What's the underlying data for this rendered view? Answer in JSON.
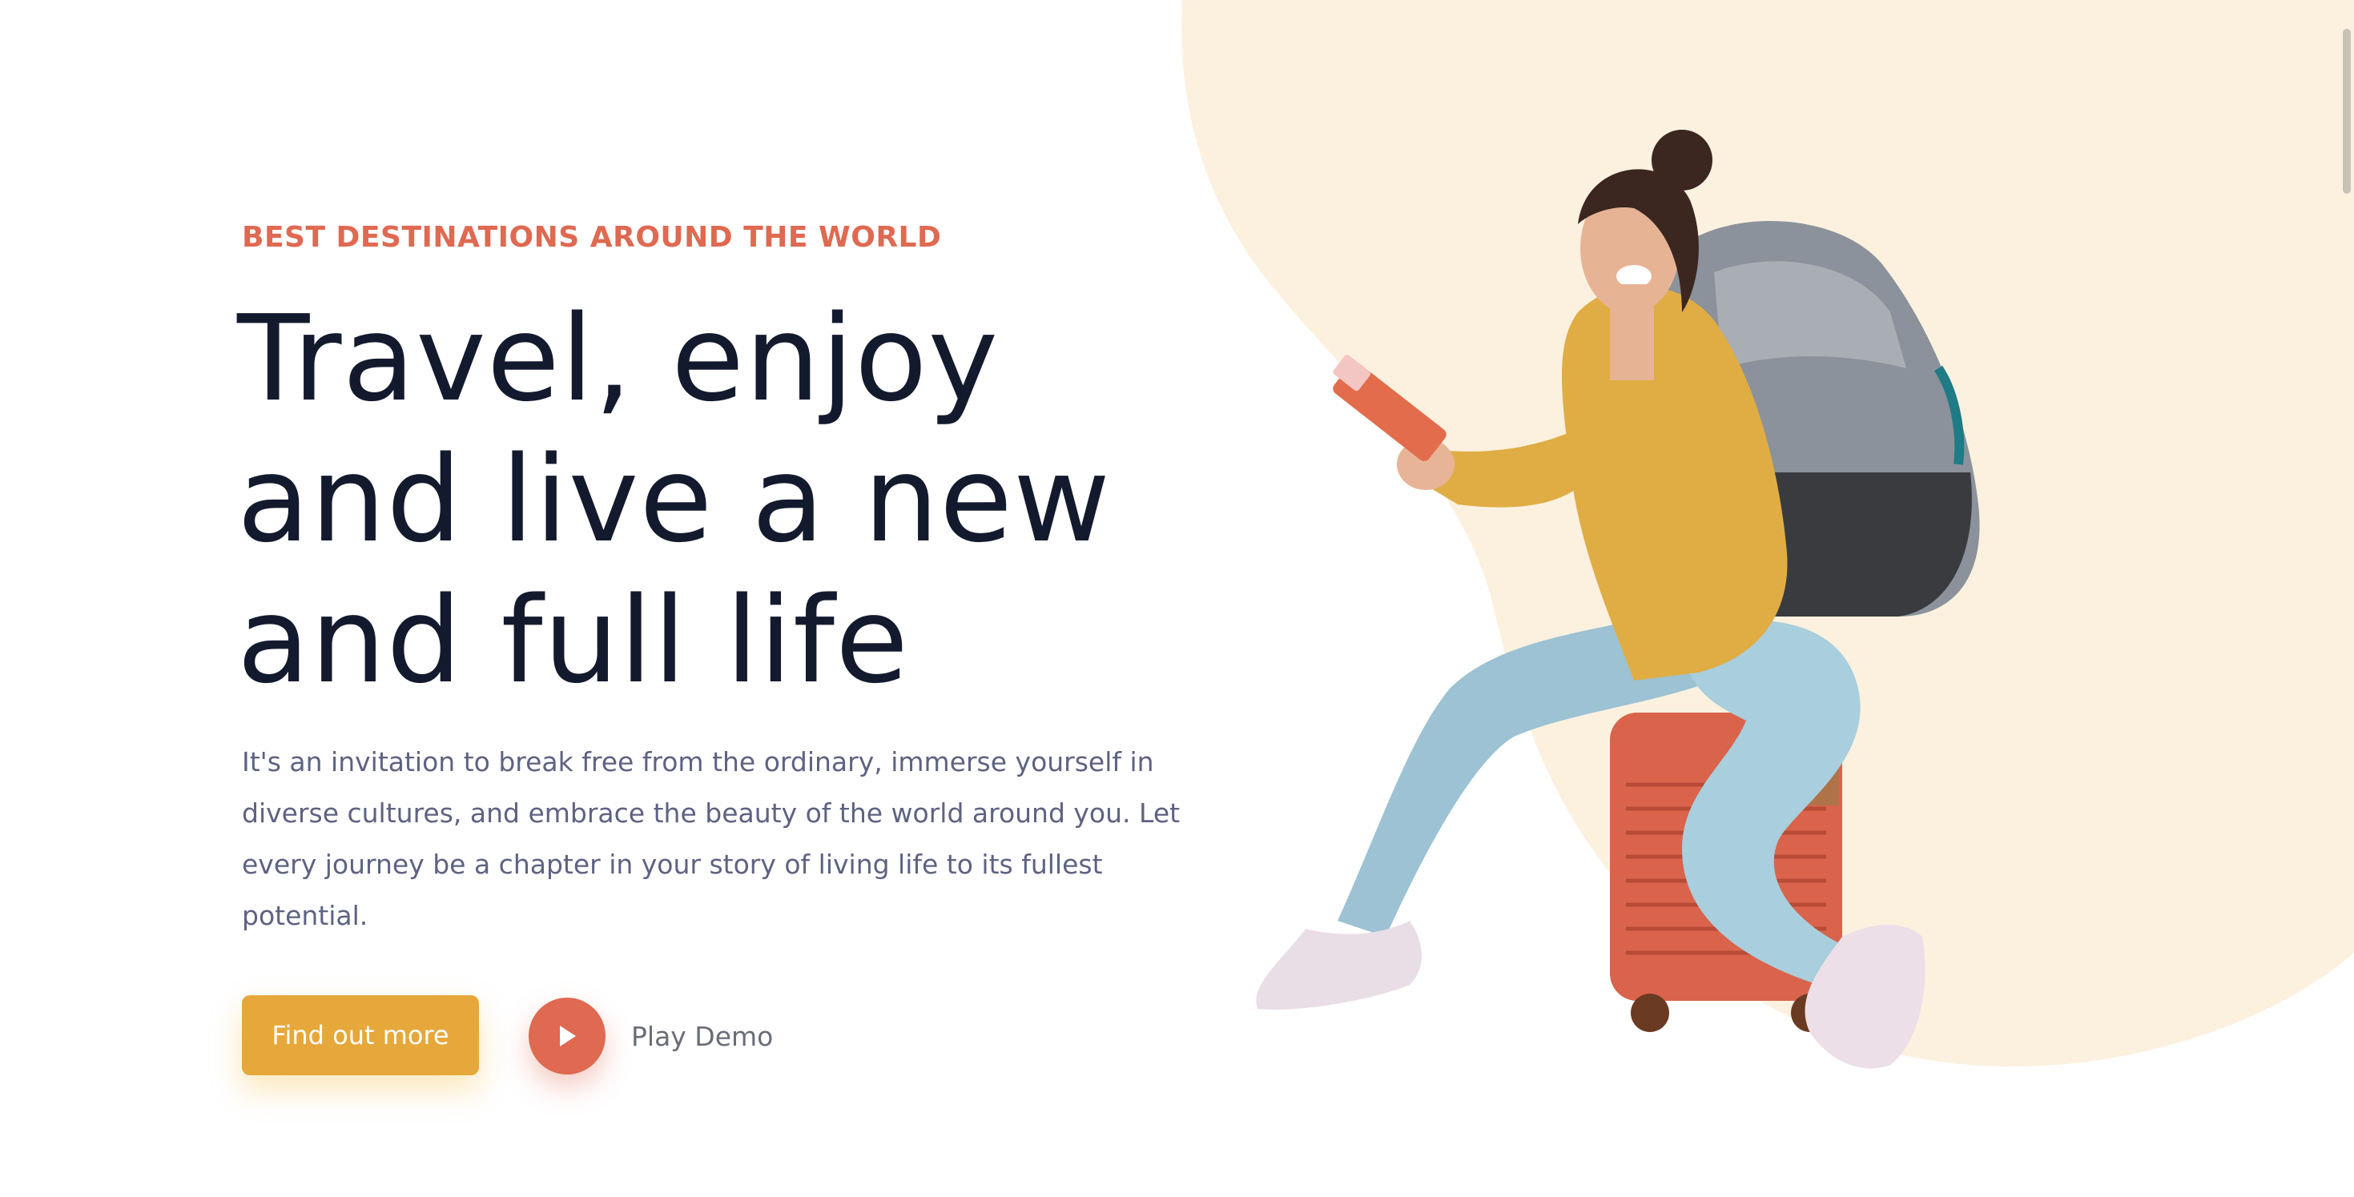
{
  "hero": {
    "eyebrow": "BEST DESTINATIONS AROUND THE WORLD",
    "headline_lines": [
      "Travel, enjoy",
      "and live a new",
      "and full life"
    ],
    "description_lines": [
      "It's an invitation to break free from the ordinary, immerse yourself in",
      "diverse cultures, and embrace the beauty of the world around you. Let",
      "every journey be a chapter in your story of living life to its fullest",
      "potential."
    ],
    "cta_label": "Find out more",
    "play_label": "Play Demo",
    "image_subject": "traveler-sitting-on-suitcase-with-backpack"
  },
  "icons": {
    "play": "play-icon"
  },
  "colors": {
    "eyebrow": "#df6951",
    "headline": "#141a2e",
    "body_text": "#5e6282",
    "cta_background": "#e6a83a",
    "play_button": "#df6951",
    "blob_background": "#fcf1df"
  }
}
